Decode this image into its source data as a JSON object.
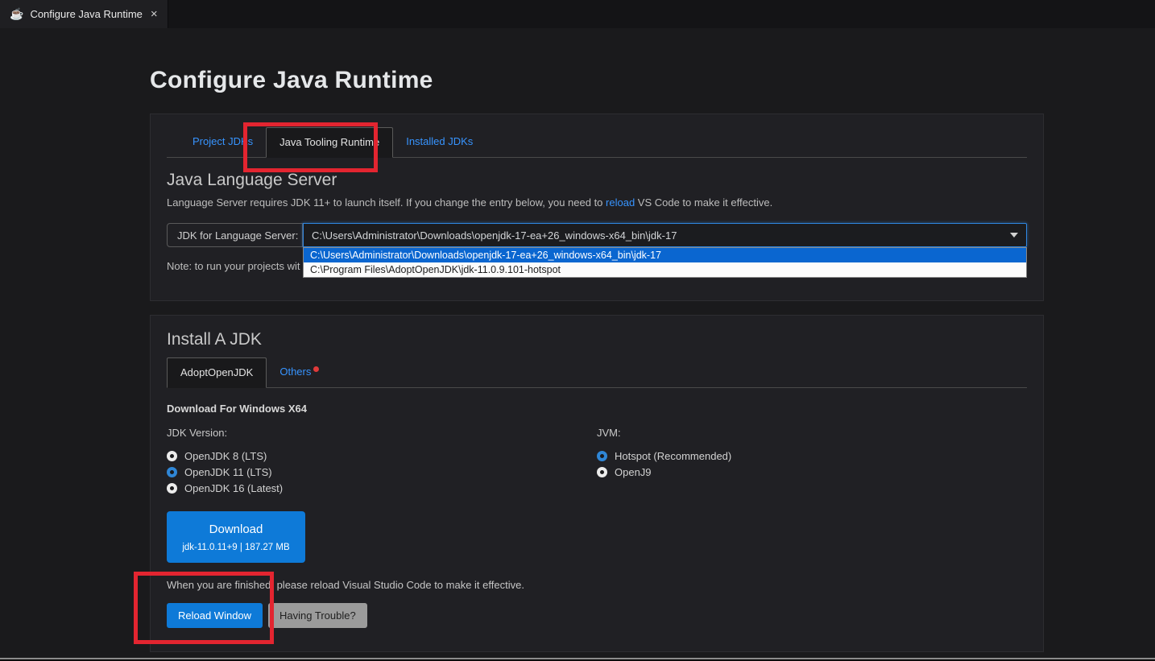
{
  "tab_bar": {
    "tab_label": "Configure Java Runtime",
    "close_glyph": "×"
  },
  "page": {
    "title": "Configure Java Runtime"
  },
  "runtime_panel": {
    "tabs": [
      {
        "label": "Project JDKs",
        "active": false
      },
      {
        "label": "Java Tooling Runtime",
        "active": true
      },
      {
        "label": "Installed JDKs",
        "active": false
      }
    ],
    "section_title": "Java Language Server",
    "description_prefix": "Language Server requires JDK 11+ to launch itself. If you change the entry below, you need to ",
    "reload_link": "reload",
    "description_suffix": " VS Code to make it effective.",
    "jdk_label": "JDK for Language Server:",
    "jdk_value": "C:\\Users\\Administrator\\Downloads\\openjdk-17-ea+26_windows-x64_bin\\jdk-17",
    "options": [
      {
        "label": "C:\\Users\\Administrator\\Downloads\\openjdk-17-ea+26_windows-x64_bin\\jdk-17",
        "selected": true
      },
      {
        "label": "C:\\Program Files\\AdoptOpenJDK\\jdk-11.0.9.101-hotspot",
        "selected": false
      }
    ],
    "note": "Note: to run your projects wit"
  },
  "install_panel": {
    "title": "Install A JDK",
    "tabs": [
      {
        "label": "AdoptOpenJDK",
        "active": true
      },
      {
        "label": "Others",
        "active": false,
        "badge": true
      }
    ],
    "download_for": "Download For Windows X64",
    "jdk_version_label": "JDK Version:",
    "jdk_versions": [
      {
        "label": "OpenJDK 8 (LTS)",
        "checked": false
      },
      {
        "label": "OpenJDK 11 (LTS)",
        "checked": true
      },
      {
        "label": "OpenJDK 16 (Latest)",
        "checked": false
      }
    ],
    "jvm_label": "JVM:",
    "jvms": [
      {
        "label": "Hotspot (Recommended)",
        "checked": true
      },
      {
        "label": "OpenJ9",
        "checked": false
      }
    ],
    "download_button": {
      "label": "Download",
      "subtext": "jdk-11.0.11+9 | 187.27 MB"
    },
    "finish_note": "When you are finished, please reload Visual Studio Code to make it effective.",
    "reload_button": "Reload Window",
    "trouble_button": "Having Trouble?"
  },
  "colors": {
    "link_blue": "#3794ff",
    "primary_blue": "#0e7ad8",
    "dropdown_highlight": "#0a66d0",
    "annotation_red": "#e32530"
  }
}
